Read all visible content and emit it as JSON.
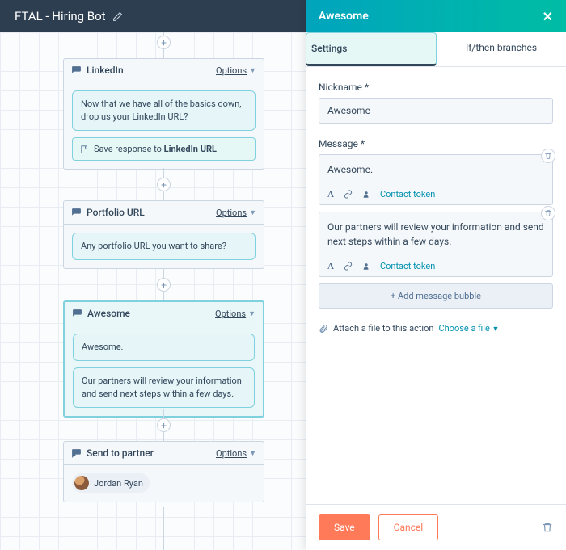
{
  "header": {
    "title": "FTAL - Hiring Bot"
  },
  "nodes": {
    "linkedin": {
      "title": "LinkedIn",
      "options": "Options",
      "msg": "Now that we have all of the basics down, drop us your LinkedIn URL?",
      "action_prefix": "Save response to ",
      "action_target": "LinkedIn URL"
    },
    "portfolio": {
      "title": "Portfolio URL",
      "options": "Options",
      "msg": "Any portfolio URL you want to share?"
    },
    "awesome": {
      "title": "Awesome",
      "options": "Options",
      "msg1": "Awesome.",
      "msg2": "Our partners will review your information and send next steps within a few days."
    },
    "send": {
      "title": "Send to partner",
      "options": "Options",
      "person": "Jordan Ryan"
    }
  },
  "panel": {
    "title": "Awesome",
    "tabs": {
      "settings": "Settings",
      "branches": "If/then branches"
    },
    "nickname_label": "Nickname *",
    "nickname_value": "Awesome",
    "message_label": "Message *",
    "msg1": "Awesome.",
    "msg2": "Our partners will review your information and send next steps within a few days.",
    "toolbar": {
      "contact_token": "Contact token"
    },
    "add_bubble": "+  Add message bubble",
    "attach_label": "Attach a file to this action",
    "choose_file": "Choose a file",
    "save": "Save",
    "cancel": "Cancel"
  }
}
